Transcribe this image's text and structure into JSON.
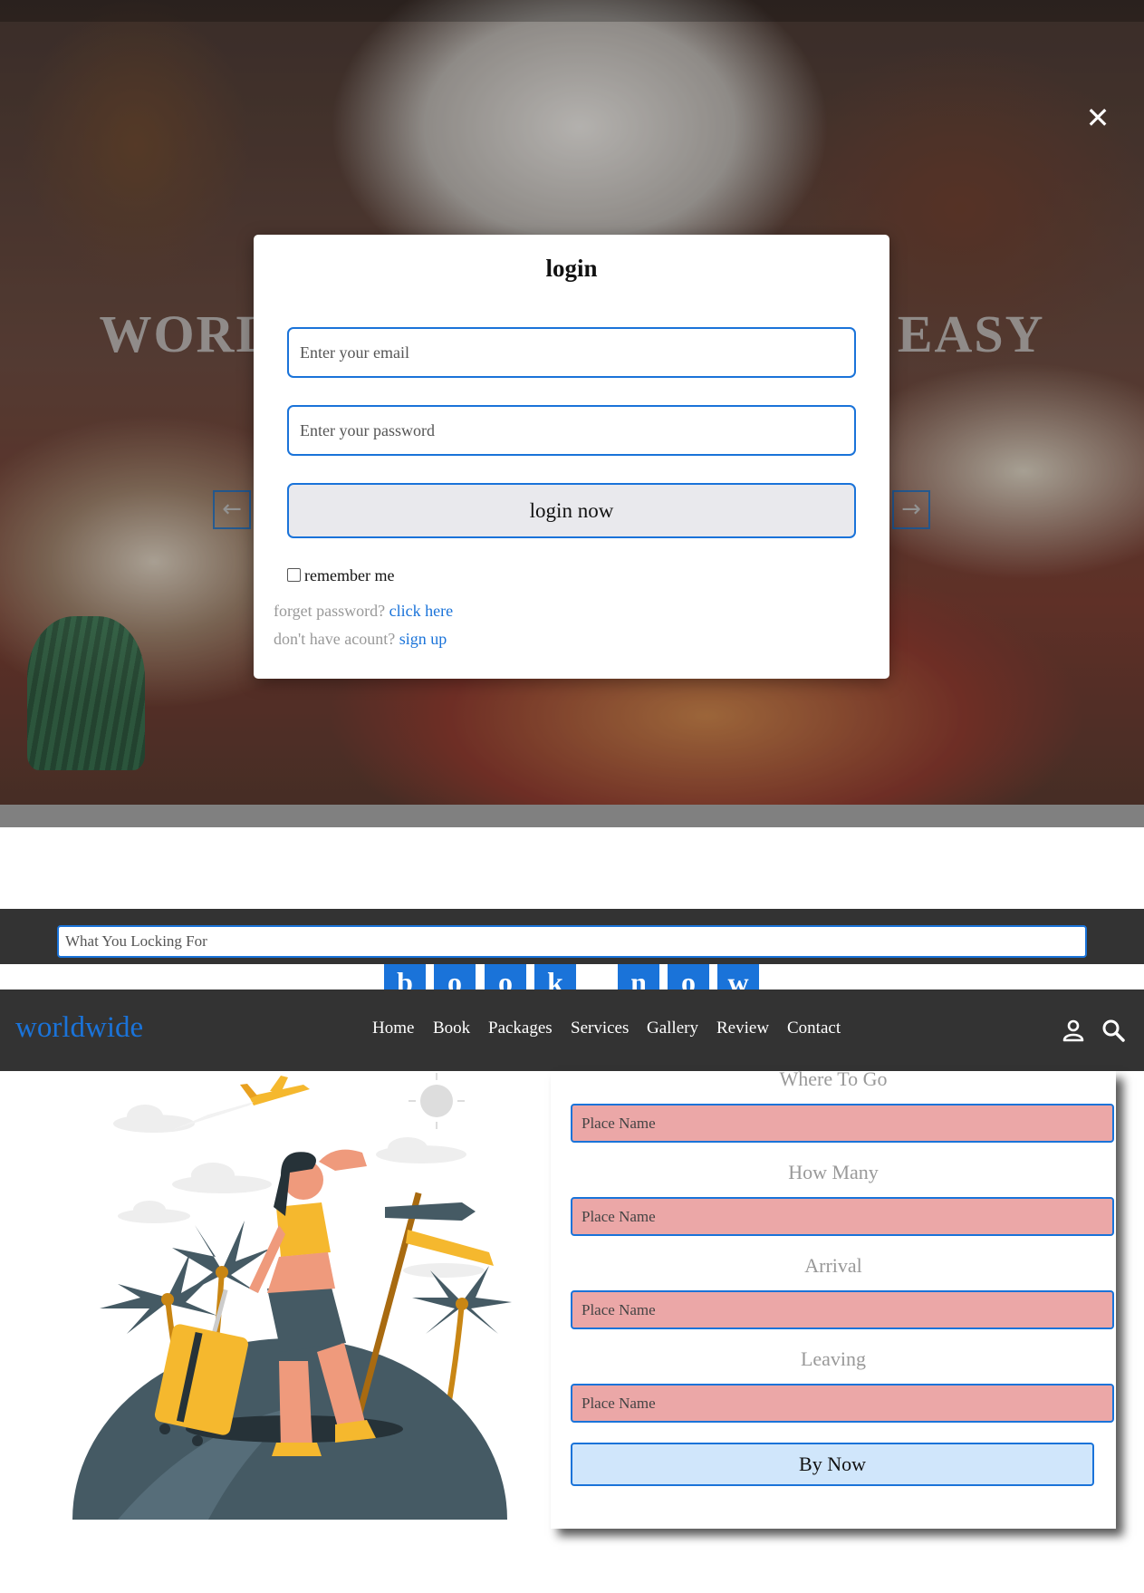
{
  "hero": {
    "title": "WORLDWIDE TRAVEL MADE EASY",
    "prev_arrow": "←",
    "next_arrow": "→",
    "close": "✕"
  },
  "login": {
    "title": "login",
    "email_placeholder": "Enter your email",
    "password_placeholder": "Enter your password",
    "submit_label": "login now",
    "remember_label": "remember me",
    "forgot_text": "forget password?",
    "forgot_link": "click here",
    "signup_text": "don't have acount?",
    "signup_link": "sign up"
  },
  "search": {
    "placeholder": "What You Locking For"
  },
  "book_now": {
    "letters": [
      "b",
      "o",
      "o",
      "k",
      "n",
      "o",
      "w"
    ]
  },
  "navbar": {
    "logo": "worldwide",
    "links": [
      "Home",
      "Book",
      "Packages",
      "Services",
      "Gallery",
      "Review",
      "Contact"
    ],
    "icons": [
      "user-icon",
      "search-icon"
    ]
  },
  "booking_form": {
    "fields": [
      {
        "label": "Where To Go",
        "placeholder": "Place Name"
      },
      {
        "label": "How Many",
        "placeholder": "Place Name"
      },
      {
        "label": "Arrival",
        "placeholder": "Place Name"
      },
      {
        "label": "Leaving",
        "placeholder": "Place Name"
      }
    ],
    "submit_label": "By Now"
  },
  "colors": {
    "accent": "#1a73d9",
    "navbar_bg": "#333333",
    "field_bg": "#eba7a7",
    "button_bg": "#d0e6fb"
  }
}
